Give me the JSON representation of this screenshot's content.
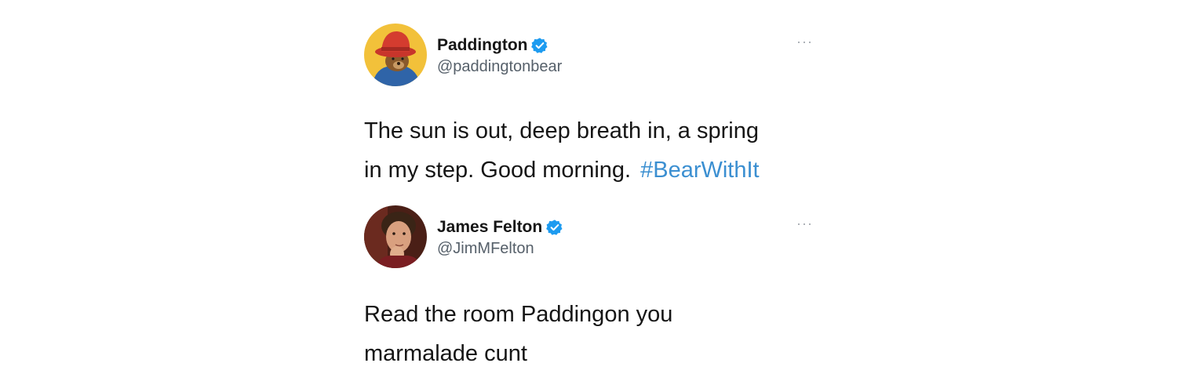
{
  "tweets": [
    {
      "display_name": "Paddington",
      "handle": "@paddingtonbear",
      "verified": true,
      "avatar_icon": "paddington-bear-avatar",
      "more_label": "···",
      "text_line1": "The sun is out, deep breath in, a spring",
      "text_line2": "in my step. Good morning.",
      "hashtag": "#BearWithIt"
    },
    {
      "display_name": "James Felton",
      "handle": "@JimMFelton",
      "verified": true,
      "avatar_icon": "user-photo-avatar",
      "more_label": "···",
      "text_line1": "Read the room Paddingon you",
      "text_line2": "marmalade cunt"
    }
  ],
  "colors": {
    "verified_blue": "#1d9bf0",
    "hashtag_blue": "#3b8fd1",
    "handle_gray": "#56606a"
  }
}
